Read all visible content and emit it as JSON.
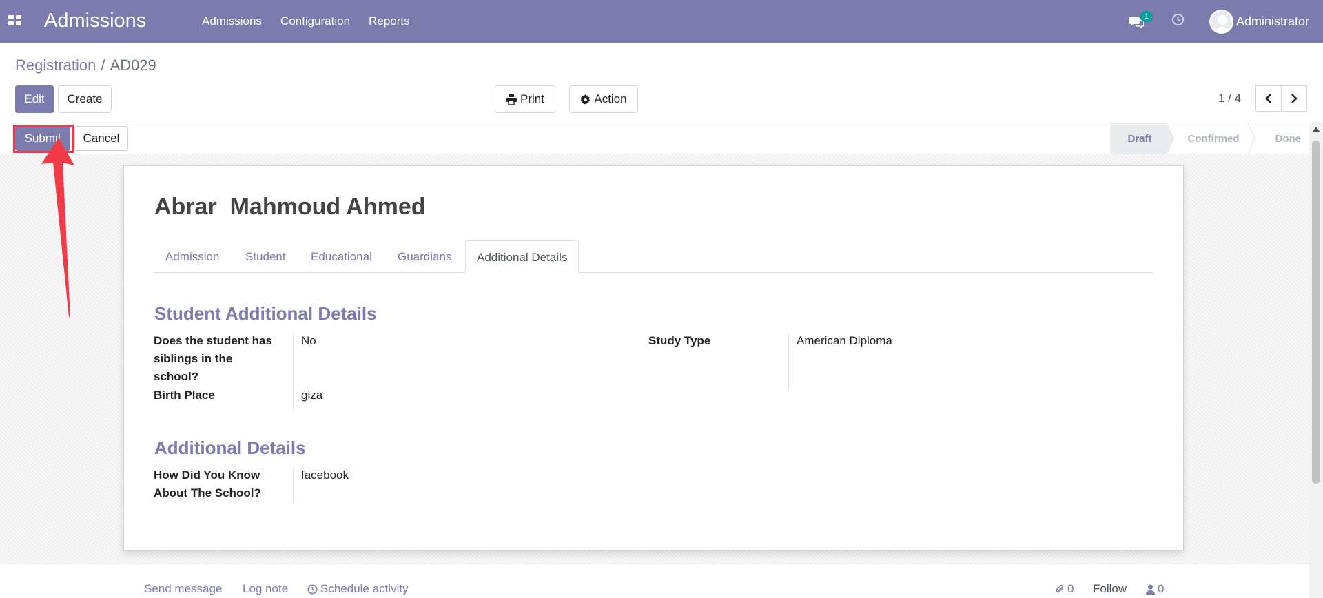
{
  "navbar": {
    "app_title": "Admissions",
    "menu": [
      "Admissions",
      "Configuration",
      "Reports"
    ],
    "messages_badge": "1",
    "user_name": "Administrator",
    "bg_color": "#7c7bad"
  },
  "breadcrumb": {
    "parent": "Registration",
    "separator": "/",
    "current": "AD029"
  },
  "buttons": {
    "edit": "Edit",
    "create": "Create",
    "print": "Print",
    "action": "Action",
    "submit": "Submit",
    "cancel": "Cancel"
  },
  "pager": {
    "value": "1 / 4"
  },
  "status_steps": [
    "Draft",
    "Confirmed",
    "Done"
  ],
  "record": {
    "title": "Abrar  Mahmoud Ahmed"
  },
  "tabs": [
    "Admission",
    "Student",
    "Educational",
    "Guardians",
    "Additional Details"
  ],
  "sections": {
    "student_additional": {
      "title": "Student Additional Details",
      "siblings_label": "Does the student has siblings in the school?",
      "siblings_value": "No",
      "birth_place_label": "Birth Place",
      "birth_place_value": "giza",
      "study_type_label": "Study Type",
      "study_type_value": "American Diploma"
    },
    "additional": {
      "title": "Additional Details",
      "know_label": "How Did You Know About The School?",
      "know_value": "facebook"
    }
  },
  "chatter": {
    "send_message": "Send message",
    "log_note": "Log note",
    "schedule_activity": "Schedule activity",
    "attachments_count": "0",
    "follow": "Follow",
    "followers_count": "0"
  },
  "icons": {
    "apps": "apps-grid-icon",
    "messages": "chat-icon",
    "activities": "clock-icon",
    "print": "print-icon",
    "action": "gear-icon",
    "paperclip": "paperclip-icon",
    "user": "user-icon"
  },
  "annotation_color": "#f03a47"
}
